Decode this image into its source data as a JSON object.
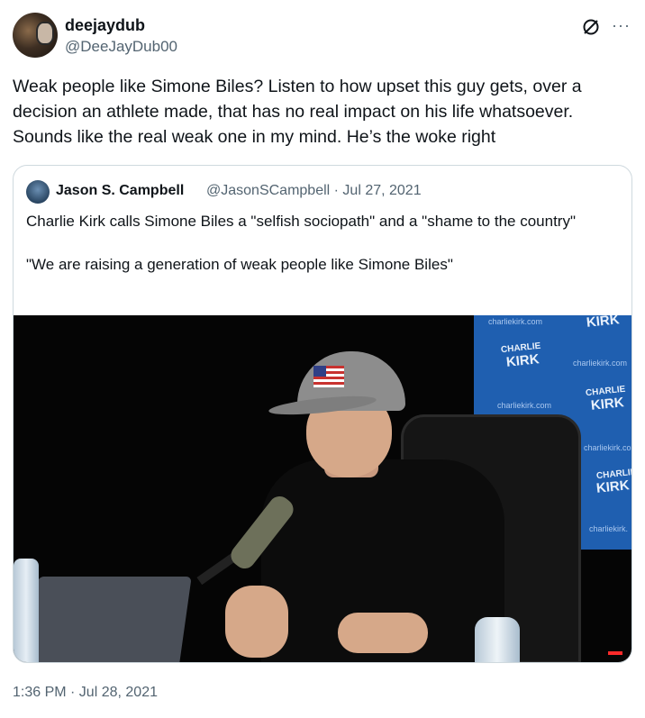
{
  "author": {
    "display_name": "deejaydub",
    "handle": "@DeeJayDub00"
  },
  "tweet": {
    "text": "Weak people like Simone Biles? Listen to how upset this guy gets, over a decision an athlete made, that has no real impact on his life whatsoever. Sounds like the real weak one in my mind. He’s the woke right",
    "timestamp": "1:36 PM · Jul 28, 2021"
  },
  "icons": {
    "grok": "grok-icon",
    "more": "more-icon",
    "more_glyph": "···"
  },
  "quoted": {
    "display_name": "Jason S. Campbell",
    "meta": "@JasonSCampbell · Jul 27, 2021",
    "paragraph_1": "Charlie Kirk calls Simone Biles a \"selfish sociopath\" and a \"shame to the country\"",
    "paragraph_2": "\"We are raising a generation of weak people like Simone Biles\"",
    "media": {
      "banner_url_text": "charliekirk.com",
      "banner_logo_line1": "CHARLIE",
      "banner_logo_line2": "KIRK",
      "banner_logo_partial": "KIRK",
      "banner_url_partial_1": "charliekirk.com",
      "banner_url_partial_2": "charliekirk.co",
      "banner_url_partial_3": "charliekirk."
    }
  },
  "colors": {
    "text_primary": "#0f1419",
    "text_secondary": "#536471",
    "border": "#cfd9de",
    "banner_blue": "#1f5fb0"
  }
}
